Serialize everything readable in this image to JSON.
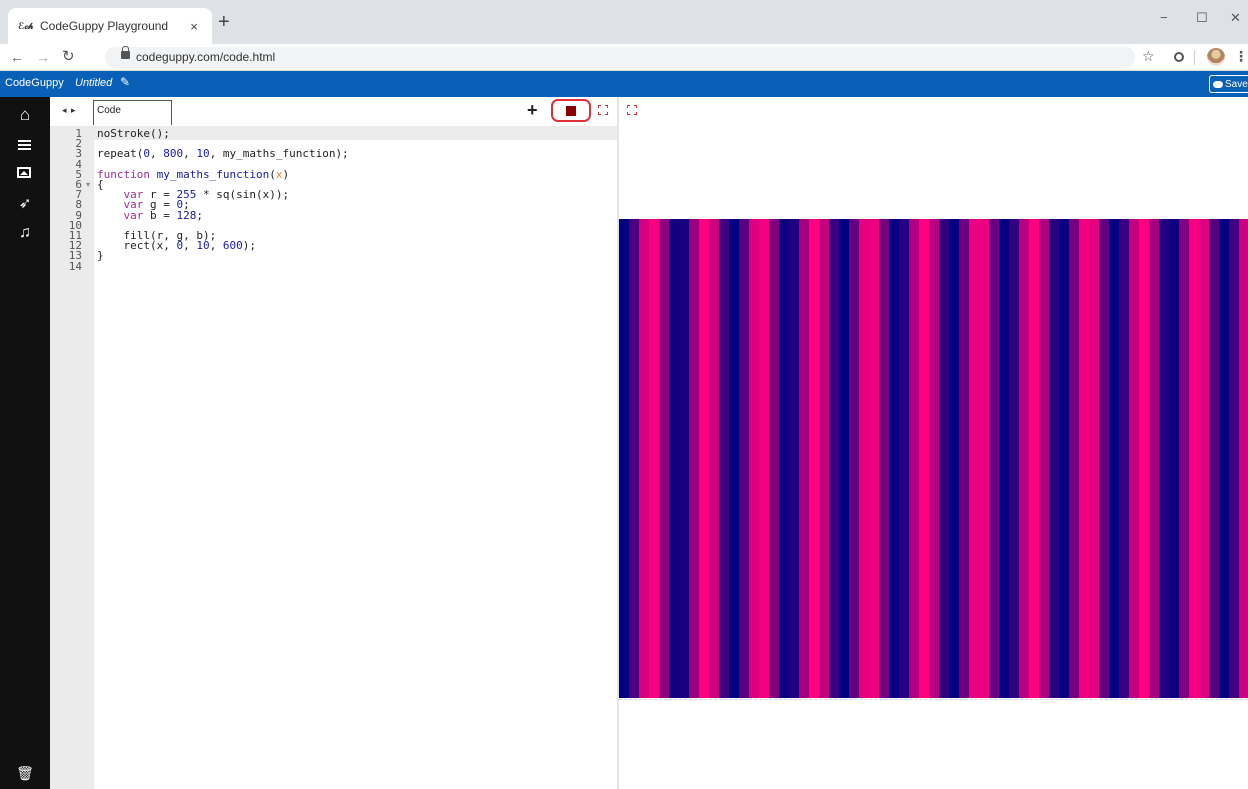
{
  "browser": {
    "tab_title": "CodeGuppy Playground",
    "tab_favicon_text": "ℰ𝒸𝒽",
    "tab_close": "×",
    "new_tab": "+",
    "url": "codeguppy.com/code.html",
    "window_controls": [
      "−",
      "☐",
      "✕"
    ]
  },
  "app": {
    "brand": "CodeGuppy",
    "document_name": "Untitled",
    "save_label": "Save",
    "accent_color": "#0a60b7"
  },
  "sidebar": {
    "items": [
      "home-icon",
      "menu-icon",
      "image-icon",
      "rocket-icon",
      "music-icon"
    ],
    "footer": "trash-icon"
  },
  "editor": {
    "tab_name": "Code",
    "nav_arrows": "◂ ▸",
    "add_label": "+",
    "run_state": "running",
    "lines": [
      {
        "n": "1",
        "html": "noStroke();"
      },
      {
        "n": "2",
        "html": ""
      },
      {
        "n": "3",
        "html": "repeat(<span class=\"num\">0</span>, <span class=\"num\">800</span>, <span class=\"num\">10</span>, my_maths_function);"
      },
      {
        "n": "4",
        "html": ""
      },
      {
        "n": "5",
        "html": "<span class=\"kw\">function</span> <span class=\"fn\">my_maths_function</span>(<span class=\"param\">x</span>)"
      },
      {
        "n": "6",
        "html": "{"
      },
      {
        "n": "7",
        "html": "    <span class=\"kw\">var</span> r = <span class=\"num\">255</span> * sq(sin(x));"
      },
      {
        "n": "8",
        "html": "    <span class=\"kw\">var</span> g = <span class=\"num\">0</span>;"
      },
      {
        "n": "9",
        "html": "    <span class=\"kw\">var</span> b = <span class=\"num\">128</span>;"
      },
      {
        "n": "10",
        "html": ""
      },
      {
        "n": "11",
        "html": "    fill(r, g, b);"
      },
      {
        "n": "12",
        "html": "    rect(x, <span class=\"num\">0</span>, <span class=\"num\">10</span>, <span class=\"num\">600</span>);"
      },
      {
        "n": "13",
        "html": "}"
      },
      {
        "n": "14",
        "html": ""
      }
    ]
  },
  "output": {
    "program": {
      "start": 0,
      "end": 800,
      "step": 10,
      "g": 0,
      "b": 128,
      "r_scale": 255
    }
  }
}
